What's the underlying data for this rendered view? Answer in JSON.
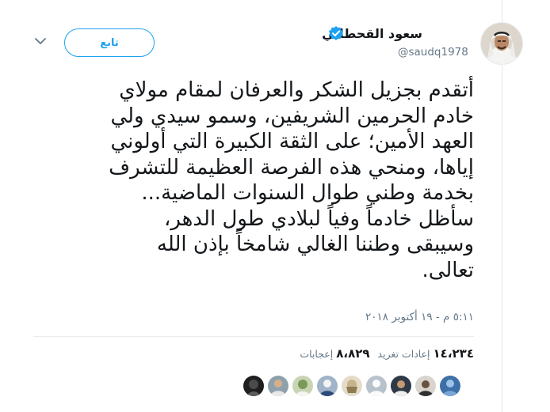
{
  "tweet": {
    "author": {
      "name": "سعود القحطاني",
      "handle": "@saudq1978",
      "verified": true
    },
    "follow_label": "تابع",
    "text": "أتقدم بجزيل الشكر والعرفان لمقام مولاي\nخادم الحرمين الشريفين، وسمو سيدي ولي\nالعهد الأمين؛ على الثقة الكبيرة التي أولوني\nإياها، ومنحي هذه الفرصة العظيمة للتشرف\nبخدمة وطني طوال السنوات الماضية...\nسأظل خادماً وفياً لبلادي طول الدهر،\nوسيبقى وطننا الغالي شامخاً بإذن الله\nتعالى.",
    "timestamp": "٥:١١ م - ١٩ أكتوبر ٢٠١٨",
    "stats": {
      "retweets_count": "١٤،٢٣٤",
      "retweets_label": "إعادات تغريد",
      "likes_count": "٨،٨٢٩",
      "likes_label": "إعجابات"
    },
    "colors": {
      "accent": "#1da1f2",
      "text": "#14171a",
      "secondary_text": "#657786",
      "divider": "#e6ecf0"
    },
    "icons": {
      "verified": "verified-badge-icon",
      "menu": "chevron-down-icon"
    }
  }
}
